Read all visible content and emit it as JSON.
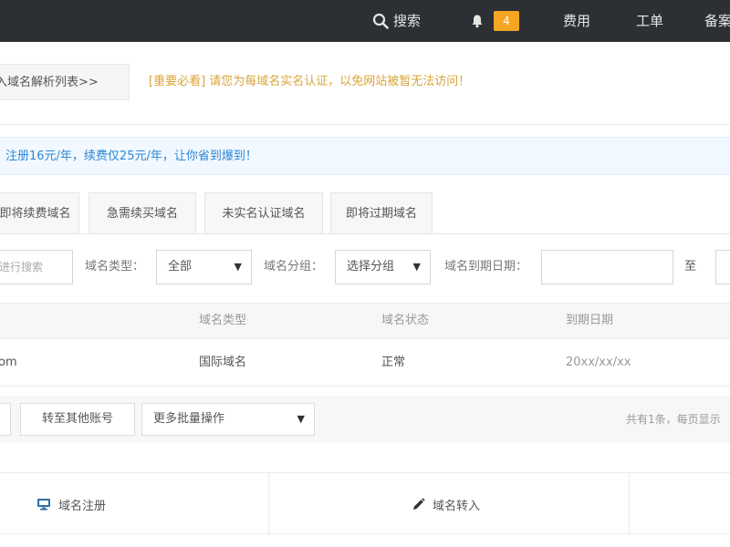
{
  "topbar": {
    "search_label": "搜索",
    "badge_count": "4",
    "fee_label": "费用",
    "order_label": "工单",
    "beian_label": "备案"
  },
  "hint": {
    "enter_list_label": "入域名解析列表>>",
    "warning_text": "[重要必看] 请您为每域名实名认证，以免网站被暂无法访问！"
  },
  "promo": {
    "text": "注册16元/年，续费仅25元/年，让你省到爆到！"
  },
  "tabs": [
    {
      "label": "即将续费域名"
    },
    {
      "label": "急需续买域名"
    },
    {
      "label": "未实名认证域名"
    },
    {
      "label": "即将过期域名"
    }
  ],
  "filters": {
    "keyword_placeholder": "进行搜索",
    "type_label": "域名类型：",
    "type_value": "全部",
    "group_label": "域名分组：",
    "group_value": "选择分组",
    "expiry_label": "域名到期日期：",
    "to_label": "至"
  },
  "table": {
    "headers": [
      "域名类型",
      "域名状态",
      "到期日期"
    ],
    "rows": [
      {
        "domain": "om",
        "type": "国际域名",
        "status": "正常",
        "expiry": "20xx/xx/xx"
      }
    ]
  },
  "bulk": {
    "transfer_label": "转至其他账号",
    "more_ops_value": "更多批量操作",
    "pager_text": "共有1条，每页显示"
  },
  "actions": {
    "register_label": "域名注册",
    "transfer_in_label": "域名转入"
  },
  "colors": {
    "topbar_bg": "#2c3035",
    "badge": "#f5a623",
    "warning": "#d9a43a",
    "promo_text": "#2b87d6"
  }
}
